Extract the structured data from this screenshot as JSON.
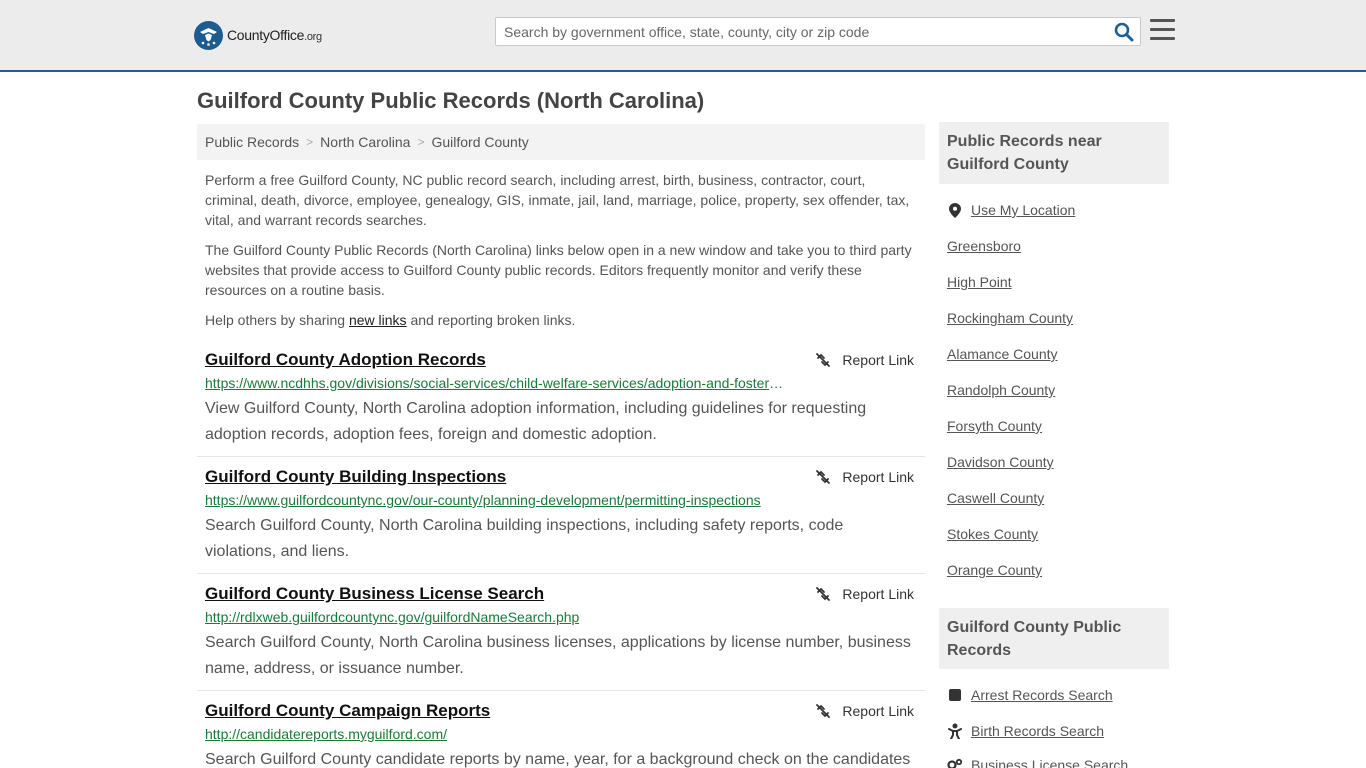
{
  "header": {
    "logo_main": "CountyOffice",
    "logo_tld": ".org",
    "search_placeholder": "Search by government office, state, county, city or zip code",
    "search_icon": "search-icon",
    "menu_icon": "hamburger-menu-icon"
  },
  "page_title": "Guilford County Public Records (North Carolina)",
  "breadcrumb": [
    {
      "label": "Public Records"
    },
    {
      "label": "North Carolina"
    },
    {
      "label": "Guilford County"
    }
  ],
  "intro": {
    "p1": "Perform a free Guilford County, NC public record search, including arrest, birth, business, contractor, court, criminal, death, divorce, employee, genealogy, GIS, inmate, jail, land, marriage, police, property, sex offender, tax, vital, and warrant records searches.",
    "p2": "The Guilford County Public Records (North Carolina) links below open in a new window and take you to third party websites that provide access to Guilford County public records. Editors frequently monitor and verify these resources on a routine basis.",
    "p3_before": "Help others by sharing ",
    "p3_link": "new links",
    "p3_after": " and reporting broken links."
  },
  "report_label": "Report Link",
  "records": [
    {
      "title": "Guilford County Adoption Records",
      "url": "https://www.ncdhhs.gov/divisions/social-services/child-welfare-services/adoption-and-foster-care",
      "desc": "View Guilford County, North Carolina adoption information, including guidelines for requesting adoption records, adoption fees, foreign and domestic adoption."
    },
    {
      "title": "Guilford County Building Inspections",
      "url": "https://www.guilfordcountync.gov/our-county/planning-development/permitting-inspections",
      "desc": "Search Guilford County, North Carolina building inspections, including safety reports, code violations, and liens."
    },
    {
      "title": "Guilford County Business License Search",
      "url": "http://rdlxweb.guilfordcountync.gov/guilfordNameSearch.php",
      "desc": "Search Guilford County, North Carolina business licenses, applications by license number, business name, address, or issuance number."
    },
    {
      "title": "Guilford County Campaign Reports",
      "url": "http://candidatereports.myguilford.com/",
      "desc": "Search Guilford County candidate reports by name, year, for a background check on the candidates"
    }
  ],
  "sidebar": {
    "near_heading": "Public Records near Guilford County",
    "use_location": "Use My Location",
    "near_links": [
      "Greensboro",
      "High Point",
      "Rockingham County",
      "Alamance County",
      "Randolph County",
      "Forsyth County",
      "Davidson County",
      "Caswell County",
      "Stokes County",
      "Orange County"
    ],
    "records_heading": "Guilford County Public Records",
    "record_links": [
      {
        "label": "Arrest Records Search",
        "icon": "square-icon"
      },
      {
        "label": "Birth Records Search",
        "icon": "baby-icon"
      },
      {
        "label": "Business License Search",
        "icon": "gears-icon"
      }
    ]
  },
  "colors": {
    "header_bg": "#ececec",
    "accent": "#1f5f95",
    "url_green": "#1a7a3a"
  }
}
